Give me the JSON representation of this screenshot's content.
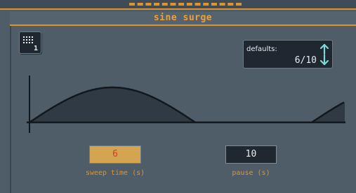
{
  "window": {
    "title": "sine surge"
  },
  "preset_button": {
    "icon": "grid-icon",
    "number": "1"
  },
  "defaults": {
    "label": "defaults:",
    "value": "6/10",
    "icon": "up-down-arrows-icon"
  },
  "controls": {
    "sweep_time": {
      "value": "6",
      "label": "sweep time (s)"
    },
    "pause": {
      "value": "10",
      "label": "pause (s)"
    }
  },
  "colors": {
    "background": "#4f5d69",
    "accent": "#e0932a",
    "box_dark": "#1f2830",
    "box_active": "#d4a550",
    "active_text": "#c9412a",
    "text_light": "#e6eef2",
    "cyan": "#7ed8d8"
  }
}
